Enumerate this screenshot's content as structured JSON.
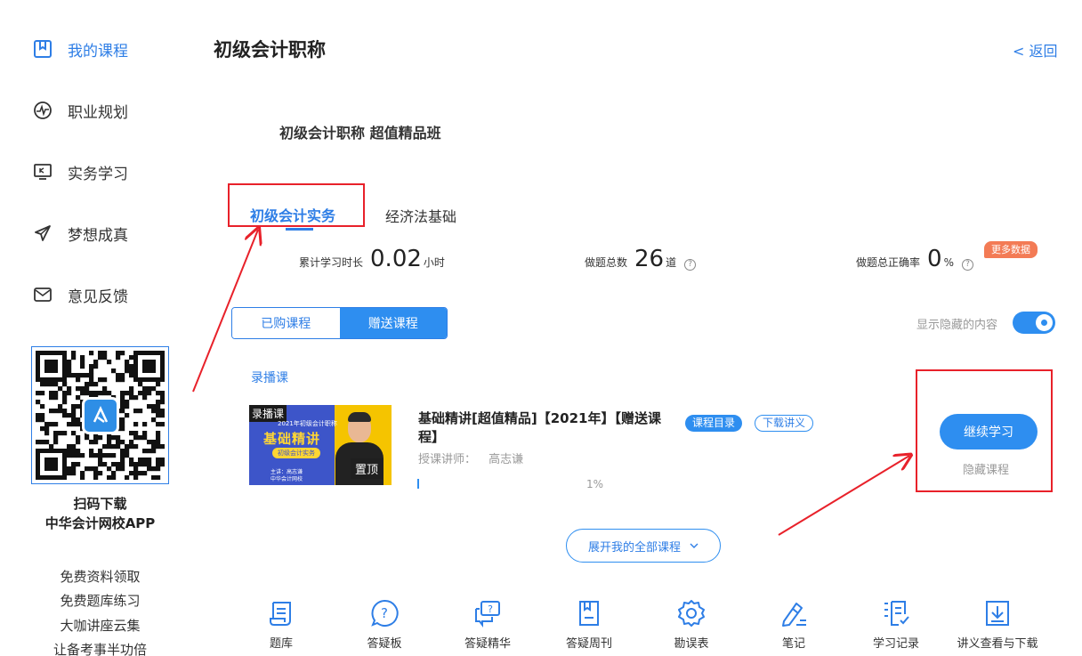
{
  "sidebar": {
    "items": [
      {
        "label": "我的课程",
        "icon": "book-icon",
        "active": true
      },
      {
        "label": "职业规划",
        "icon": "pulse-icon",
        "active": false
      },
      {
        "label": "实务学习",
        "icon": "monitor-icon",
        "active": false
      },
      {
        "label": "梦想成真",
        "icon": "paper-plane-icon",
        "active": false
      },
      {
        "label": "意见反馈",
        "icon": "mail-icon",
        "active": false
      }
    ],
    "qr_caption_1": "扫码下载",
    "qr_caption_2": "中华会计网校APP",
    "links": [
      "免费资料领取",
      "免费题库练习",
      "大咖讲座云集",
      "让备考事半功倍"
    ]
  },
  "header": {
    "title": "初级会计职称",
    "back": "< 返回"
  },
  "course_title": "初级会计职称 超值精品班",
  "subject_tabs": [
    {
      "label": "初级会计实务",
      "active": true
    },
    {
      "label": "经济法基础",
      "active": false
    }
  ],
  "stats": {
    "study_time_label": "累计学习时长",
    "study_time_value": "0.02",
    "study_time_unit": "小时",
    "questions_label": "做题总数",
    "questions_value": "26",
    "questions_unit": "道",
    "accuracy_label": "做题总正确率",
    "accuracy_value": "0",
    "accuracy_unit": "%",
    "more_data": "更多数据"
  },
  "segment": {
    "purchased": "已购课程",
    "gifted": "赠送课程",
    "selected": "赠送课程"
  },
  "show_hidden": {
    "label": "显示隐藏的内容",
    "on": true
  },
  "section_label": "录播课",
  "course": {
    "thumbnail": {
      "tag": "录播课",
      "year_line": "2021年初级会计职称",
      "headline": "基础精讲",
      "subject": "初级会计实务",
      "teacher": "主讲：高志谦",
      "school": "中华会计网校",
      "pin": "置顶"
    },
    "name": "基础精讲[超值精品]【2021年】【赠送课程】",
    "catalog": "课程目录",
    "download": "下载讲义",
    "teacher_label": "授课讲师：",
    "teacher_name": "高志谦",
    "progress": "1%",
    "continue": "继续学习",
    "hide": "隐藏课程"
  },
  "expand": "展开我的全部课程",
  "tools": [
    {
      "label": "题库",
      "icon": "scroll-icon"
    },
    {
      "label": "答疑板",
      "icon": "question-bubble-icon"
    },
    {
      "label": "答疑精华",
      "icon": "chat-question-icon"
    },
    {
      "label": "答疑周刊",
      "icon": "journal-icon"
    },
    {
      "label": "勘误表",
      "icon": "gear-icon"
    },
    {
      "label": "笔记",
      "icon": "pen-icon"
    },
    {
      "label": "学习记录",
      "icon": "checklist-icon"
    },
    {
      "label": "讲义查看与下载",
      "icon": "download-doc-icon"
    }
  ],
  "colors": {
    "accent": "#2e8ef0",
    "annotation": "#e8212a",
    "badge": "#f37b55"
  }
}
